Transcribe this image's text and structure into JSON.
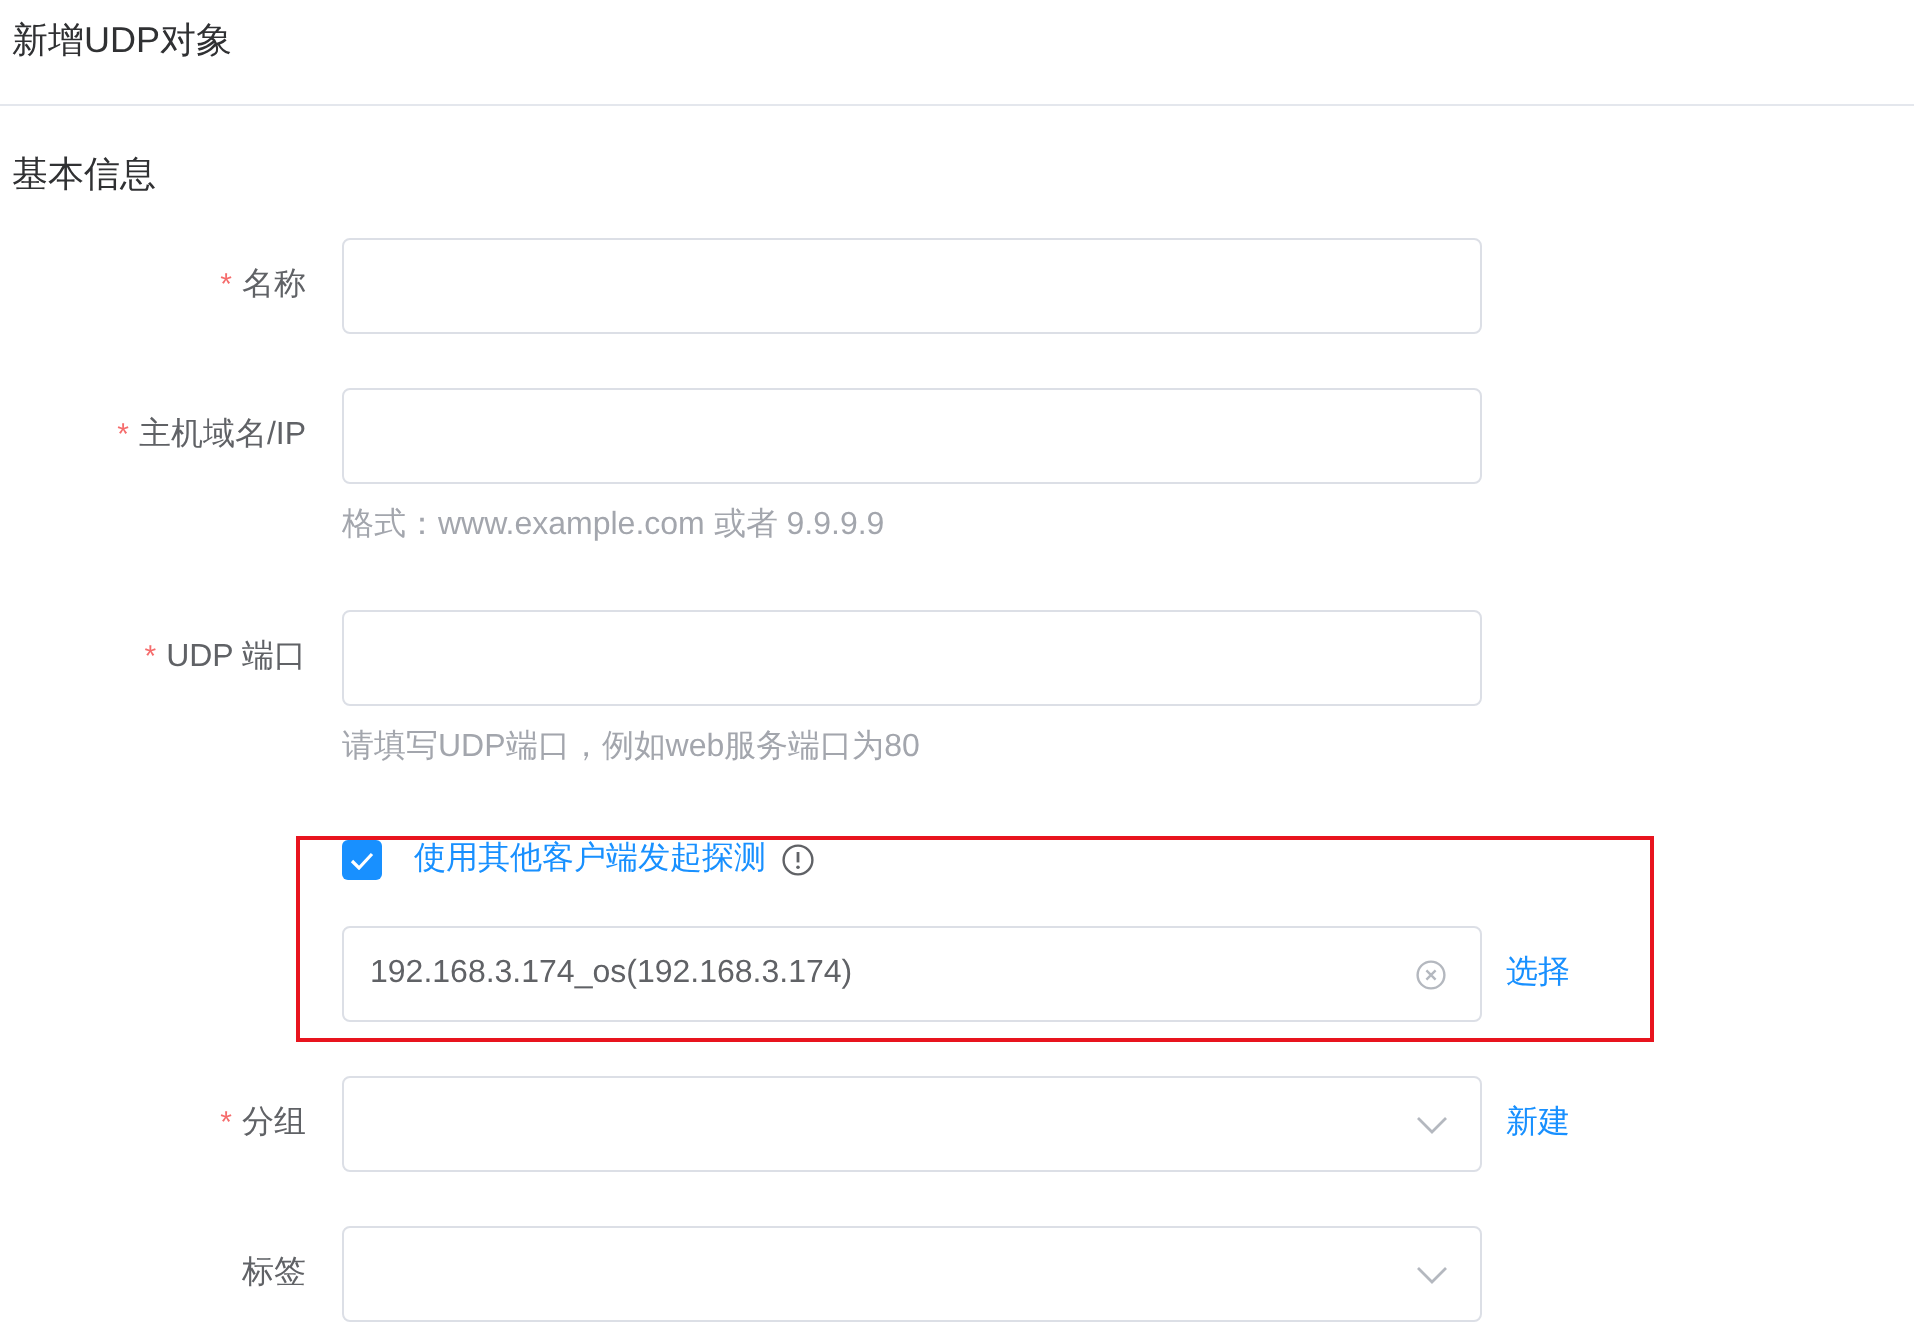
{
  "page": {
    "title": "新增UDP对象"
  },
  "section": {
    "title": "基本信息"
  },
  "fields": [
    {
      "kind": "input",
      "required_mark": "*",
      "label": "名称"
    },
    {
      "kind": "input",
      "required_mark": "*",
      "label": "主机域名/IP",
      "hint": "格式：www.example.com 或者 9.9.9.9"
    },
    {
      "kind": "input",
      "required_mark": "*",
      "label": "UDP 端口",
      "hint": "请填写UDP端口，例如web服务端口为80"
    },
    {
      "kind": "probe",
      "highlighted": true,
      "checkbox": {
        "label": "使用其他客户端发起探测",
        "checked": true
      },
      "client": {
        "value": "192.168.3.174_os(192.168.3.174)",
        "action": "选择"
      }
    },
    {
      "kind": "select",
      "required_mark": "*",
      "label": "分组",
      "action": "新建"
    },
    {
      "kind": "select",
      "label": "标签"
    }
  ]
}
